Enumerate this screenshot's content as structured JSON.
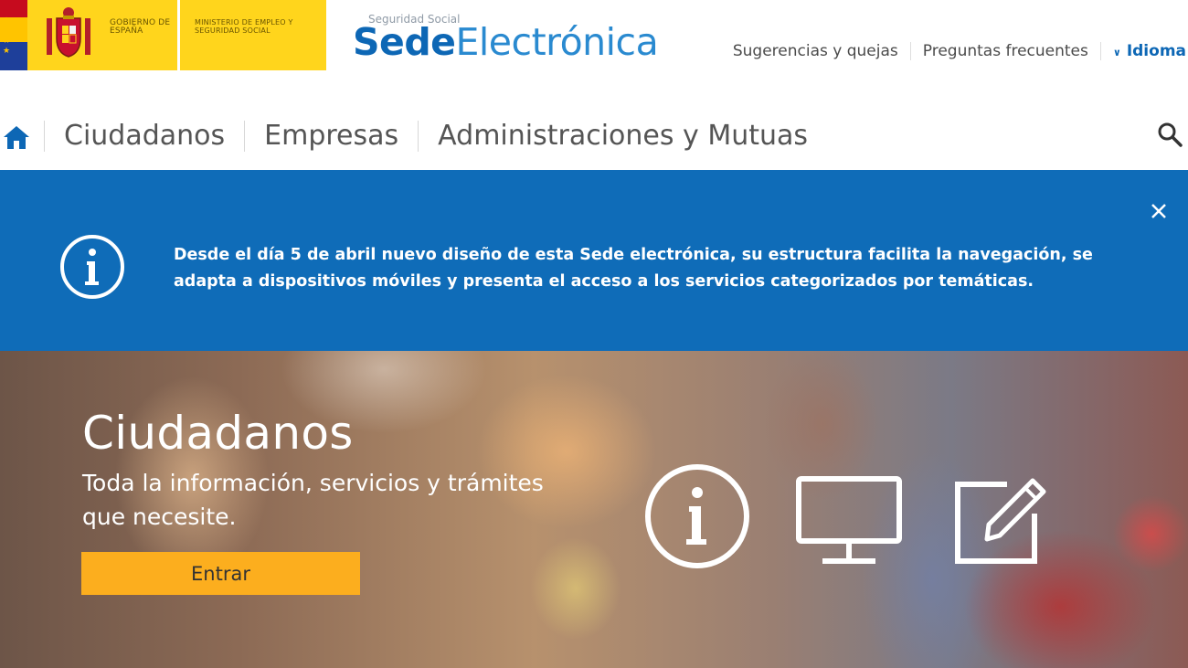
{
  "header": {
    "government_label": "GOBIERNO DE ESPAÑA",
    "ministry_label": "MINISTERIO DE EMPLEO Y SEGURIDAD SOCIAL",
    "brand_top": "Seguridad Social",
    "brand_sede": "Sede",
    "brand_electronica": "Electrónica",
    "links": [
      "Sugerencias y quejas",
      "Preguntas frecuentes"
    ],
    "idioma": "Idioma",
    "colors": {
      "yellow": "#ffd51c",
      "blue": "#0d67b5"
    }
  },
  "nav": {
    "items": [
      "Ciudadanos",
      "Empresas",
      "Administraciones y Mutuas"
    ]
  },
  "notice": {
    "text": "Desde el día 5 de abril nuevo diseño de esta Sede electrónica, su estructura facilita la navegación, se adapta a dispositivos móviles y presenta el acceso a los servicios categorizados por temáticas.",
    "color": "#0f6cb8"
  },
  "hero": {
    "title": "Ciudadanos",
    "subtitle": "Toda la información, servicios y trámites que necesite.",
    "button_label": "Entrar",
    "button_color": "#fcae1e",
    "icons": [
      "info-icon",
      "monitor-icon",
      "edit-form-icon"
    ]
  }
}
